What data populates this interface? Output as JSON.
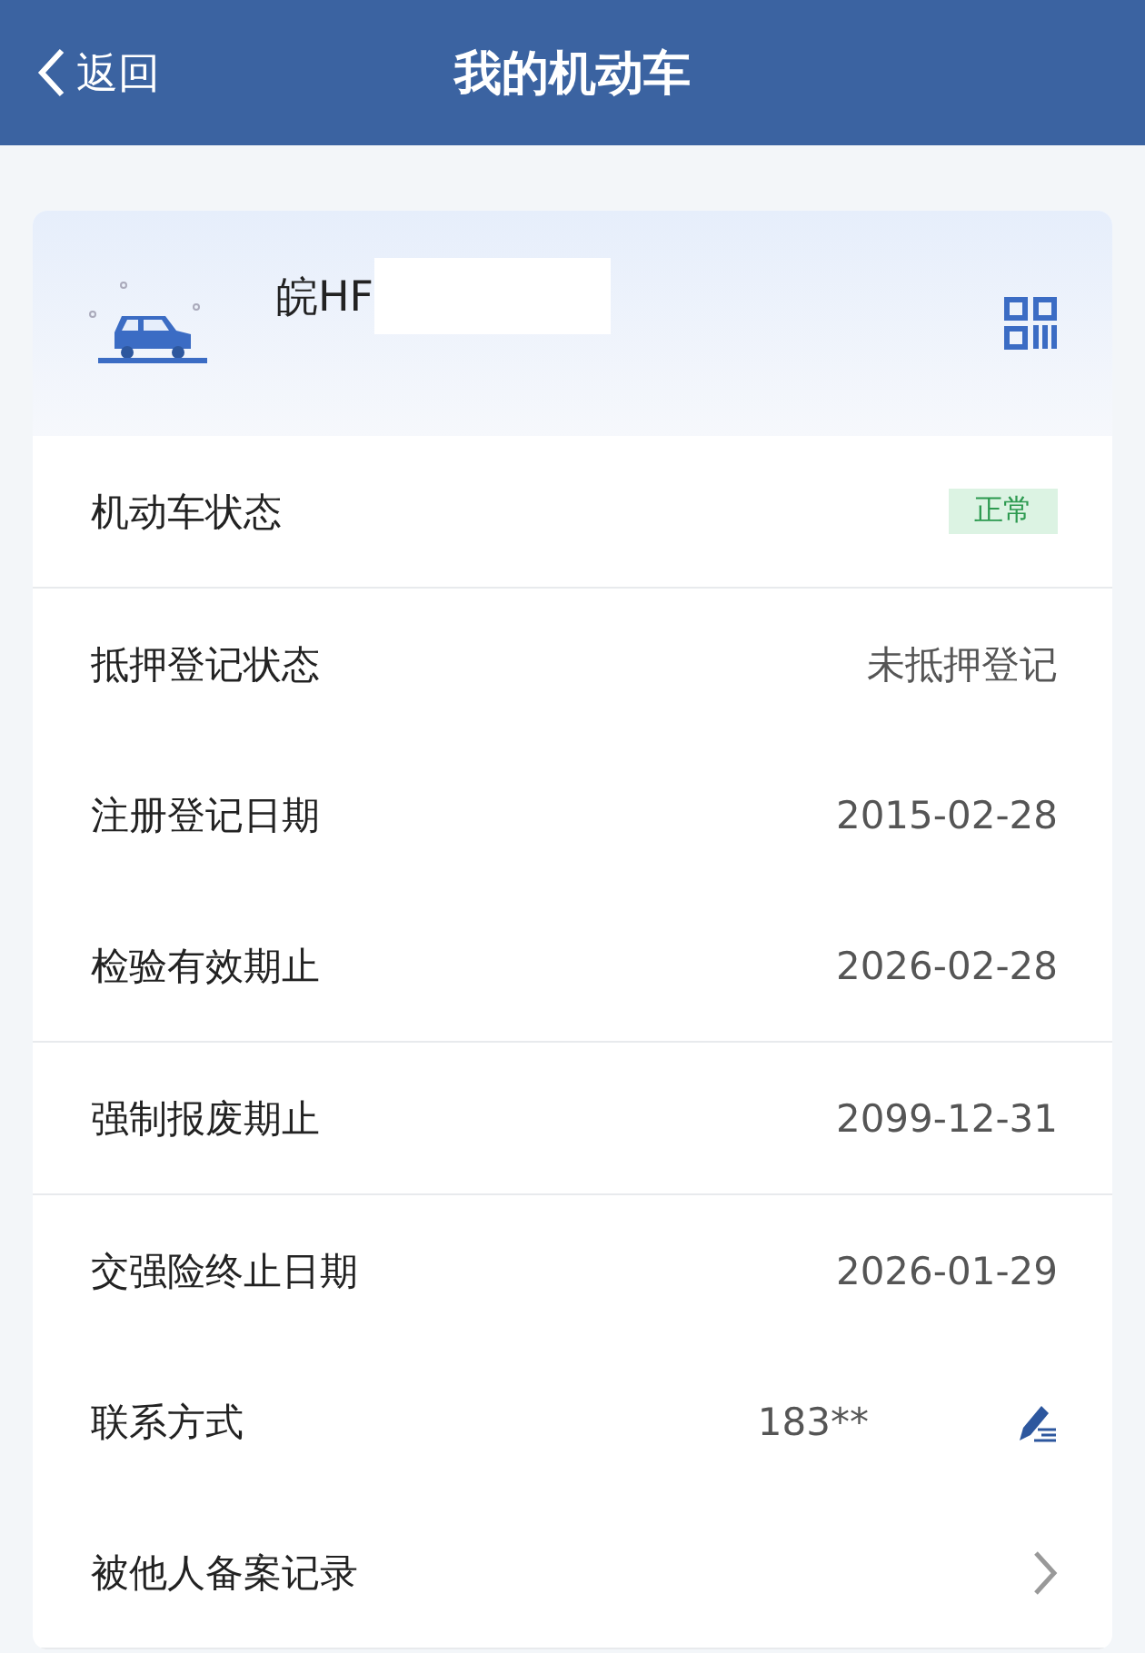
{
  "header": {
    "back_label": "返回",
    "title": "我的机动车"
  },
  "vehicle": {
    "plate": "皖HF"
  },
  "sections": [
    [
      {
        "kind": "badge",
        "label": "机动车状态",
        "value": "正常"
      }
    ],
    [
      {
        "kind": "text",
        "label": "抵押登记状态",
        "value": "未抵押登记"
      },
      {
        "kind": "text",
        "label": "注册登记日期",
        "value": "2015-02-28"
      },
      {
        "kind": "text",
        "label": "检验有效期止",
        "value": "2026-02-28"
      }
    ],
    [
      {
        "kind": "text",
        "label": "强制报废期止",
        "value": "2099-12-31"
      }
    ],
    [
      {
        "kind": "text",
        "label": "交强险终止日期",
        "value": "2026-01-29"
      },
      {
        "kind": "edit",
        "label": "联系方式",
        "value": "183**"
      },
      {
        "kind": "link",
        "label": "被他人备案记录"
      }
    ]
  ]
}
